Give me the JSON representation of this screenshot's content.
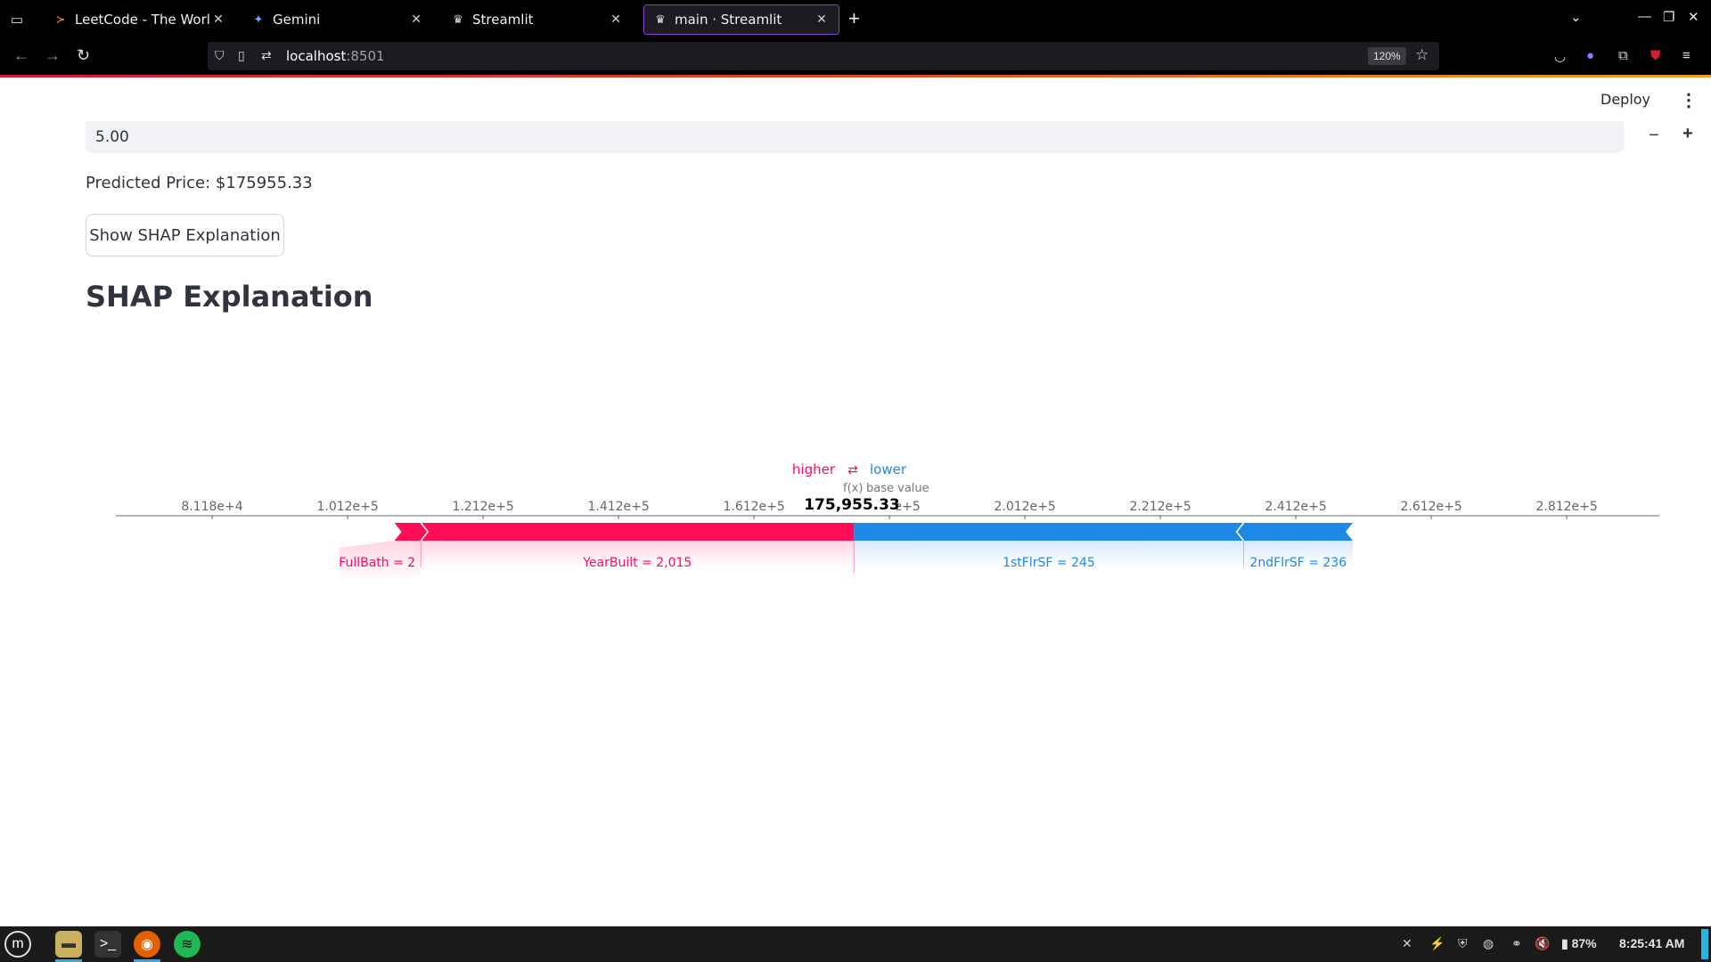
{
  "browser": {
    "tabs": [
      {
        "title": "LeetCode - The World's L",
        "icon": "leetcode-icon"
      },
      {
        "title": "Gemini",
        "icon": "gemini-icon"
      },
      {
        "title": "Streamlit",
        "icon": "streamlit-icon"
      },
      {
        "title": "main · Streamlit",
        "icon": "streamlit-icon"
      }
    ],
    "url_host": "localhost",
    "url_port": ":8501",
    "zoom": "120%"
  },
  "app": {
    "deploy_label": "Deploy",
    "number_input_value": "5.00",
    "minus_label": "−",
    "plus_label": "+",
    "prediction": "Predicted Price: $175955.33",
    "shap_button_label": "Show SHAP Explanation",
    "section_title": "SHAP Explanation"
  },
  "chart_data": {
    "type": "force-plot",
    "legend_higher": "higher",
    "legend_arrow": "⇄",
    "legend_lower": "lower",
    "fx_label": "f(x)",
    "base_label": "base value",
    "output_value": 175955.33,
    "output_label": "175,955.33",
    "tick_labels": [
      "8.118e+4",
      "1.012e+5",
      "1.212e+5",
      "1.412e+5",
      "1.612e+5",
      "1.812e+5",
      "2.012e+5",
      "2.212e+5",
      "2.412e+5",
      "2.612e+5",
      "2.812e+5"
    ],
    "tick_values": [
      81180,
      101200,
      121200,
      141200,
      161200,
      181200,
      201200,
      221200,
      241200,
      261200,
      281200
    ],
    "xlim": [
      71000,
      295000
    ],
    "positive_features": [
      {
        "label": "FullBath = 2",
        "start": 108100,
        "end": 112000
      },
      {
        "label": "YearBuilt = 2,015",
        "start": 112000,
        "end": 175955
      }
    ],
    "negative_features": [
      {
        "label": "1stFlrSF = 245",
        "start": 175955,
        "end": 233500
      },
      {
        "label": "2ndFlrSF = 236",
        "start": 233500,
        "end": 249600
      }
    ],
    "colors": {
      "positive": "#ff0d57",
      "negative": "#1e88e5",
      "axis": "#666666"
    }
  },
  "taskbar": {
    "battery": "87%",
    "time": "8:25:41 AM"
  }
}
